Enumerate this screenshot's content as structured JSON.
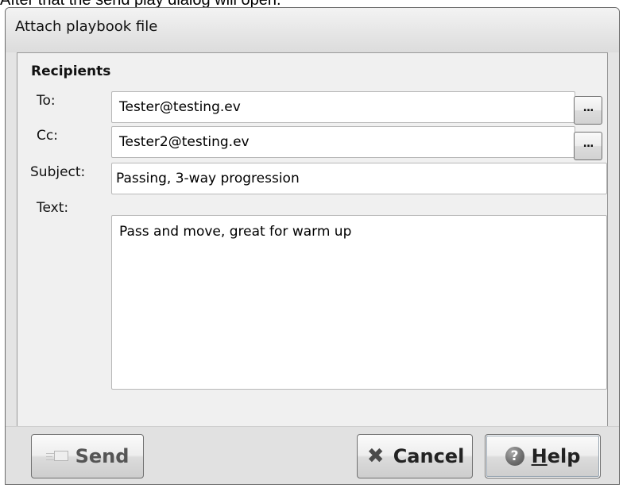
{
  "caption": "After that the send play dialog will open.",
  "dialog": {
    "title": "Attach playbook file",
    "group_label": "Recipients",
    "to": {
      "label": "To:",
      "value": "Tester@testing.ev",
      "lookup_label": "..."
    },
    "cc": {
      "label": "Cc:",
      "value": "Tester2@testing.ev",
      "lookup_label": "..."
    },
    "subject": {
      "label": "Subject:",
      "value": "Passing, 3-way progression"
    },
    "text": {
      "label": "Text:",
      "value": "Pass and move, great for warm up"
    }
  },
  "buttons": {
    "send": {
      "label": "Send",
      "icon": "envelope-icon",
      "enabled": false
    },
    "cancel": {
      "label": "Cancel",
      "icon": "x-icon"
    },
    "help": {
      "label_underlined": "H",
      "label_rest": "elp",
      "icon": "question-circle-icon",
      "focused": true
    }
  }
}
